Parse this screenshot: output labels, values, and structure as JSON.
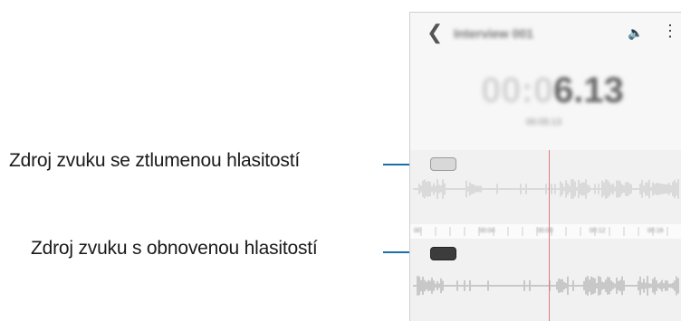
{
  "callouts": {
    "muted_label": "Zdroj zvuku se ztlumenou hlasitostí",
    "restored_label": "Zdroj zvuku s obnovenou hlasitostí"
  },
  "screen": {
    "back_icon": "chevron-left-icon",
    "back_glyph": "❮",
    "title": "Interview 001",
    "speaker_icon": "speaker-icon",
    "speaker_glyph": "🔈",
    "more_icon": "more-vertical-icon",
    "more_glyph": "⋮",
    "timer_dim": "00:0",
    "timer_bright": "6.13",
    "sub_time": "00:05:13",
    "timeline_labels": [
      "00",
      "00:04",
      "00:08",
      "00:12",
      "00:16"
    ]
  },
  "colors": {
    "leader": "#1a6fa6",
    "playhead": "#e07a80"
  }
}
